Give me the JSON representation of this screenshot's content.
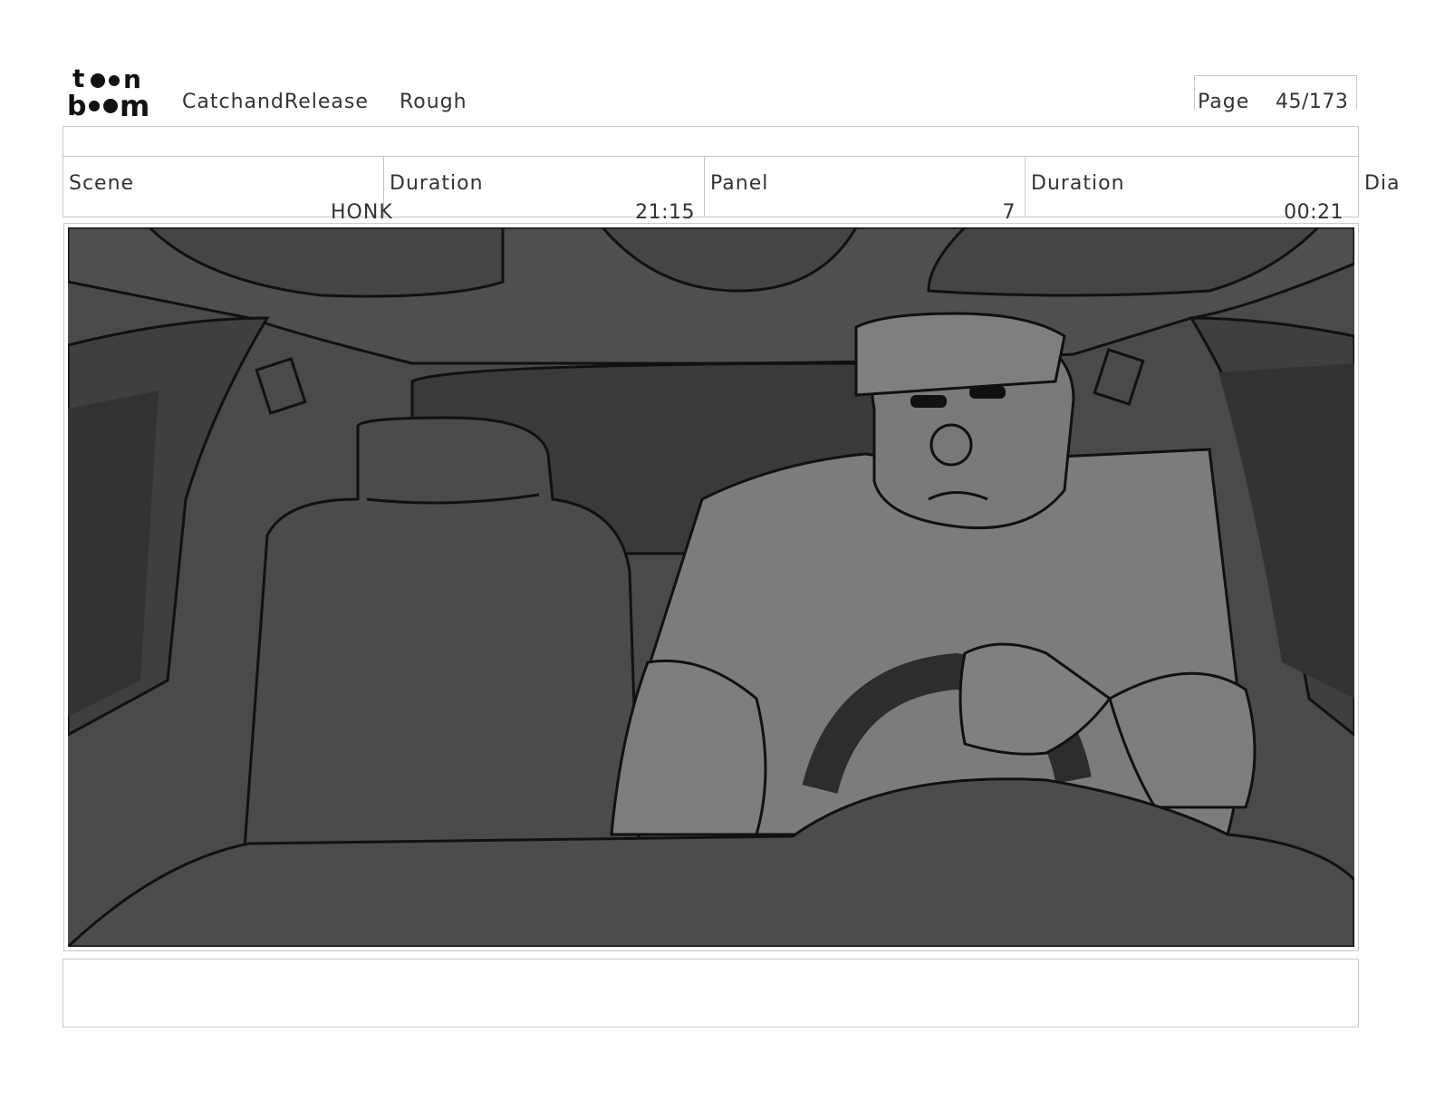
{
  "header": {
    "brand_logo_text": "toon boom",
    "project_name": "CatchandRelease",
    "version": "Rough",
    "page_label": "Page",
    "page_number": "45/173"
  },
  "info_row": {
    "scene_label": "Scene",
    "scene_value": "HONK",
    "scene_duration_label": "Duration",
    "scene_duration_value": "21:15",
    "panel_label": "Panel",
    "panel_value": "7",
    "panel_duration_label": "Duration",
    "panel_duration_value": "00:21",
    "dialogue_label": "Dia"
  },
  "panel_image": {
    "description_icon": "storyboard-frame"
  },
  "notes": {}
}
